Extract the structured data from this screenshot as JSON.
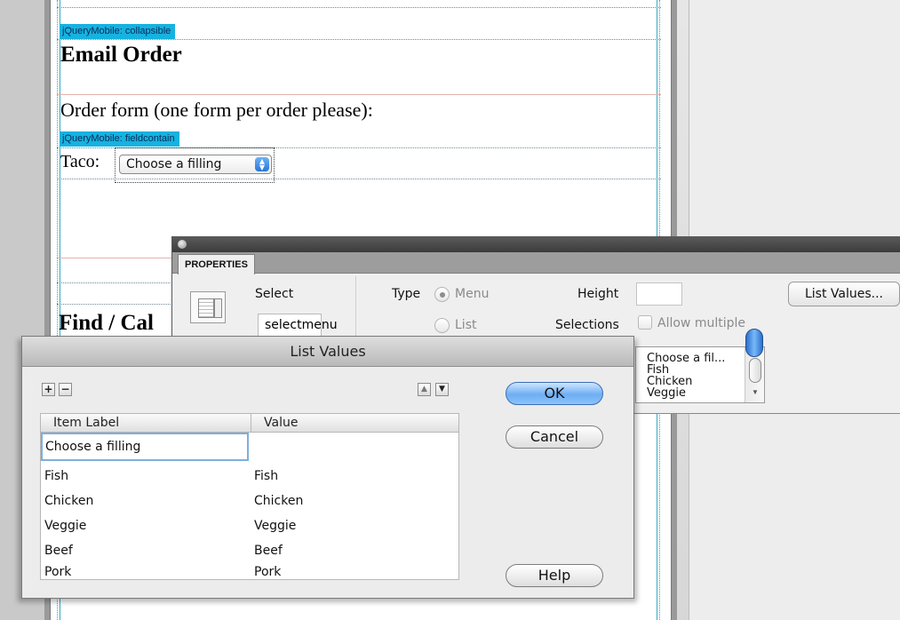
{
  "editor": {
    "collapsible_tag": "jQueryMobile: collapsible",
    "heading_email": "Email Order",
    "order_text": "Order form (one form per order please):",
    "fieldcontain_tag": "jQueryMobile: fieldcontain",
    "taco_label": "Taco:",
    "taco_select_value": "Choose a filling",
    "heading_find": "Find / Cal"
  },
  "properties": {
    "tab_label": "PROPERTIES",
    "select_label": "Select",
    "select_name": "selectmenu",
    "type_label": "Type",
    "radio_menu": "Menu",
    "radio_list": "List",
    "height_label": "Height",
    "selections_label": "Selections",
    "allow_multiple": "Allow multiple",
    "list_values_button": "List Values...",
    "preview_items": [
      "Choose a fil...",
      "Fish",
      "Chicken",
      "Veggie"
    ]
  },
  "dialog": {
    "title": "List Values",
    "add_symbol": "+",
    "remove_symbol": "−",
    "up_symbol": "▲",
    "down_symbol": "▼",
    "columns": [
      "Item Label",
      "Value"
    ],
    "editing_label": "Choose a filling",
    "rows": [
      {
        "label": "Fish",
        "value": "Fish"
      },
      {
        "label": "Chicken",
        "value": "Chicken"
      },
      {
        "label": "Veggie",
        "value": "Veggie"
      },
      {
        "label": "Beef",
        "value": "Beef"
      },
      {
        "label": "Pork",
        "value": "Pork"
      }
    ],
    "ok": "OK",
    "cancel": "Cancel",
    "help": "Help"
  }
}
